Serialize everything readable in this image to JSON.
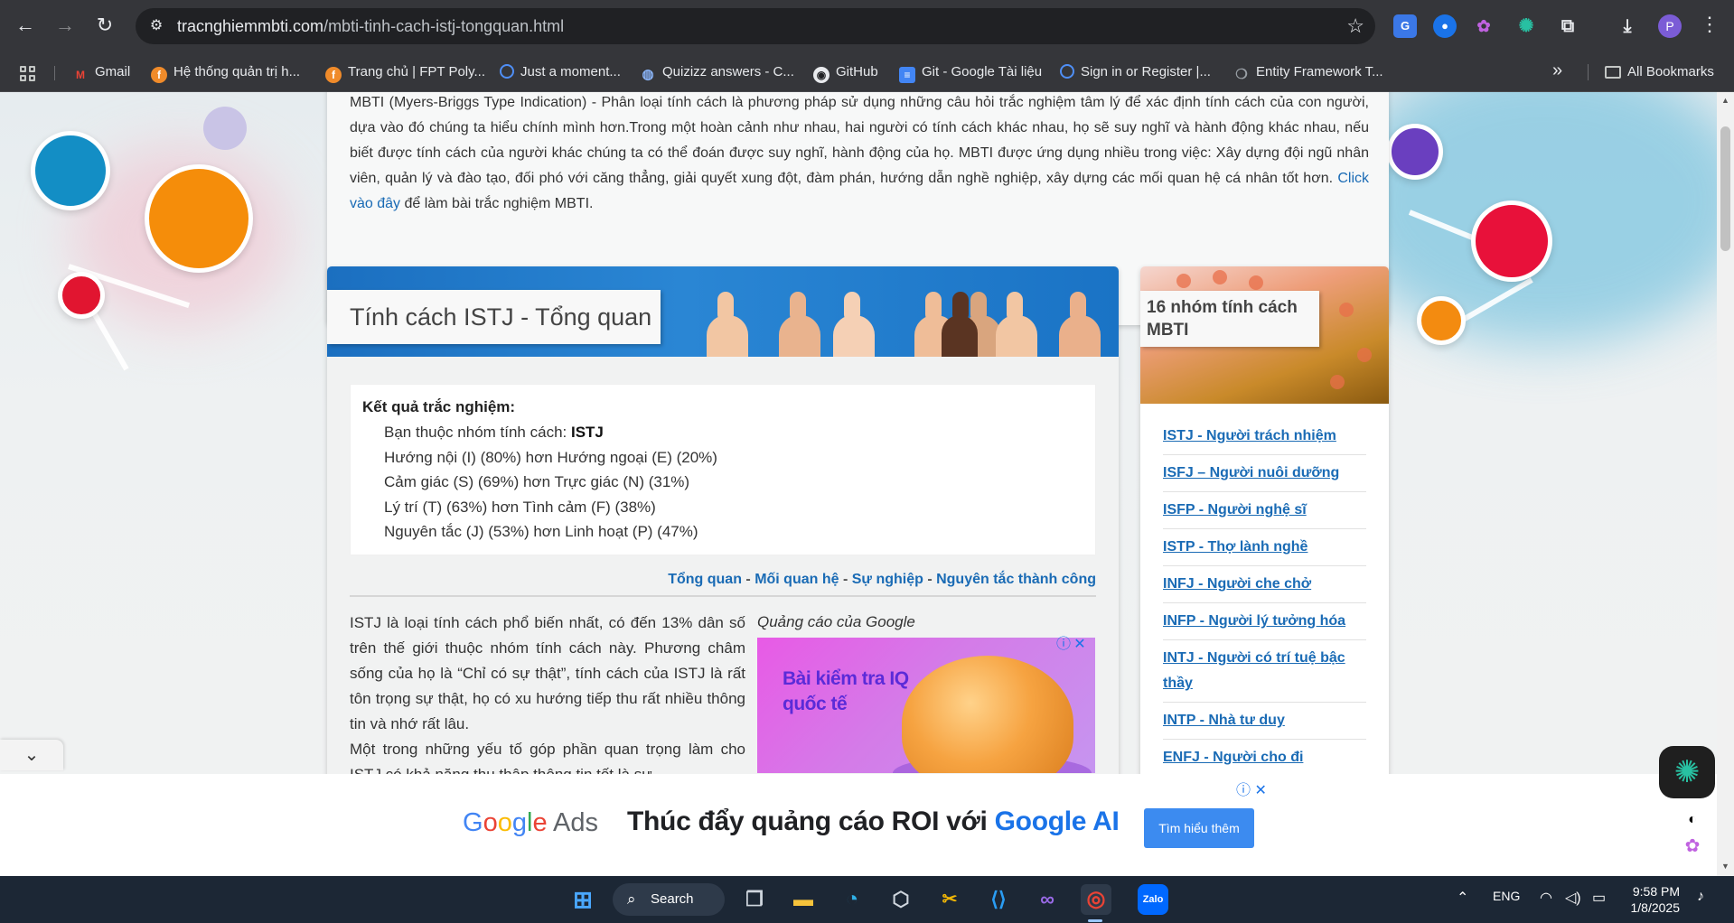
{
  "browser": {
    "url_host": "tracnghiemmbti.com",
    "url_path": "/mbti-tinh-cach-istj-tongquan.html",
    "bookmarks": [
      {
        "label": "Gmail",
        "icon": "gmail-icon"
      },
      {
        "label": "Hệ thống quản trị h...",
        "icon": "fpt-icon"
      },
      {
        "label": "Trang chủ | FPT Poly...",
        "icon": "fpt-icon"
      },
      {
        "label": "Just a moment...",
        "icon": "loading-circle-icon"
      },
      {
        "label": "Quizizz answers - C...",
        "icon": "globe-icon"
      },
      {
        "label": "GitHub",
        "icon": "github-icon"
      },
      {
        "label": "Git - Google Tài liệu",
        "icon": "docs-icon"
      },
      {
        "label": "Sign in or Register |...",
        "icon": "loading-circle-icon"
      },
      {
        "label": "Entity Framework T...",
        "icon": "ef-icon"
      }
    ],
    "all_bookmarks_label": "All Bookmarks",
    "profile_initial": "P"
  },
  "intro": {
    "text": "MBTI (Myers-Briggs Type Indication) - Phân loại tính cách là phương pháp sử dụng những câu hỏi trắc nghiệm tâm lý để xác định tính cách của con người, dựa vào đó chúng ta hiểu chính mình hơn.Trong một hoàn cảnh như nhau, hai người có tính cách khác nhau, họ sẽ suy nghĩ và hành động khác nhau, nếu biết được tính cách của người khác chúng ta có thể đoán được suy nghĩ, hành động của họ. MBTI được ứng dụng nhiều trong việc: Xây dựng đội ngũ nhân viên, quản lý và đào tạo, đối phó với căng thẳng, giải quyết xung đột, đàm phán, hướng dẫn nghề nghiệp, xây dựng các mối quan hệ cá nhân tốt hơn. ",
    "link": "Click vào đây",
    "after_link": " để làm bài trắc nghiệm MBTI."
  },
  "main": {
    "title": "Tính cách ISTJ - Tổng quan",
    "result_heading": "Kết quả trắc nghiệm:",
    "group_prefix": "Bạn thuộc nhóm tính cách: ",
    "group_value": "ISTJ",
    "lines": [
      "Hướng nội (I) (80%) hơn Hướng ngoại (E) (20%)",
      "Cảm giác (S) (69%) hơn Trực giác (N) (31%)",
      "Lý trí (T) (63%) hơn Tình cảm (F) (38%)",
      "Nguyên tắc (J) (53%) hơn Linh hoạt (P) (47%)"
    ],
    "tabs": [
      "Tổng quan",
      "Mối quan hệ",
      "Sự nghiệp",
      "Nguyên tắc thành công"
    ],
    "tab_separator": " - ",
    "article_p1": "ISTJ là loại tính cách phổ biến nhất, có đến 13% dân số trên thế giới thuộc nhóm tính cách này. Phương châm sống của họ là “Chỉ có sự thật”, tính cách của ISTJ là rất tôn trọng sự thật, họ có xu hướng tiếp thu rất nhiều thông tin và nhớ rất lâu.",
    "article_p2": "Một trong những yếu tố góp phần quan trọng làm cho ISTJ có khả năng thu thập thông tin tốt là sự",
    "ad_label": "Quảng cáo của Google",
    "ad_title": "Bài kiểm tra IQ quốc tế",
    "ad_info": "ⓘ",
    "ad_close": "✕"
  },
  "sidebar": {
    "title": "16 nhóm tính cách MBTI",
    "items": [
      "ISTJ - Người trách nhiệm",
      "ISFJ – Người nuôi dưỡng",
      "ISFP - Người nghệ sĩ",
      "ISTP - Thợ lành nghề",
      "INFJ - Người che chở",
      "INFP - Người lý tưởng hóa",
      "INTJ - Người có trí tuệ bậc thầy",
      "INTP - Nhà tư duy",
      "ENFJ - Người cho đi"
    ]
  },
  "bottom_ad": {
    "logo_google": "Google",
    "logo_ads": "Ads",
    "headline": "Thúc đẩy quảng cáo ROI với ",
    "headline_ai": "Google AI",
    "cta": "Tìm hiểu thêm"
  },
  "taskbar": {
    "search_label": "Search",
    "lang": "ENG",
    "time": "9:58 PM",
    "date": "1/8/2025"
  },
  "colors": {
    "link": "#1a6bb5",
    "banner_blue": "#1b6fc0",
    "chrome_dark": "#35363a",
    "taskbar": "#1c2735"
  }
}
